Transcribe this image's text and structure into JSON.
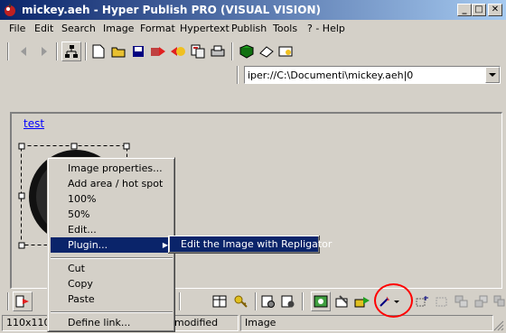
{
  "window": {
    "title": "mickey.aeh - Hyper Publish PRO (VISUAL VISION)",
    "minimize": "_",
    "maximize": "□",
    "close": "✕"
  },
  "menubar": {
    "items": [
      "File",
      "Edit",
      "Search",
      "Image",
      "Format",
      "Hypertext",
      "Publish",
      "Tools",
      "? - Help"
    ]
  },
  "address": {
    "value": "iper://C:\\Documenti\\mickey.aeh|0"
  },
  "document": {
    "link_text": "test"
  },
  "context_menu": {
    "items": [
      {
        "label": "Image properties..."
      },
      {
        "label": "Add area / hot spot"
      },
      {
        "label": "100%"
      },
      {
        "label": "50%"
      },
      {
        "label": "Edit..."
      },
      {
        "label": "Plugin...",
        "selected": true,
        "submenu_arrow": "▶"
      },
      {
        "label": "Cut"
      },
      {
        "label": "Copy"
      },
      {
        "label": "Paste"
      },
      {
        "label": "Define link..."
      }
    ]
  },
  "submenu": {
    "item": "Edit the Image with Repligator"
  },
  "status": {
    "size": "110x110",
    "modified": "modified",
    "type": "Image"
  },
  "colors": {
    "title_start": "#0a246a",
    "title_end": "#a6caf0",
    "selection": "#0a246a",
    "highlight_circle": "#ff0000"
  }
}
